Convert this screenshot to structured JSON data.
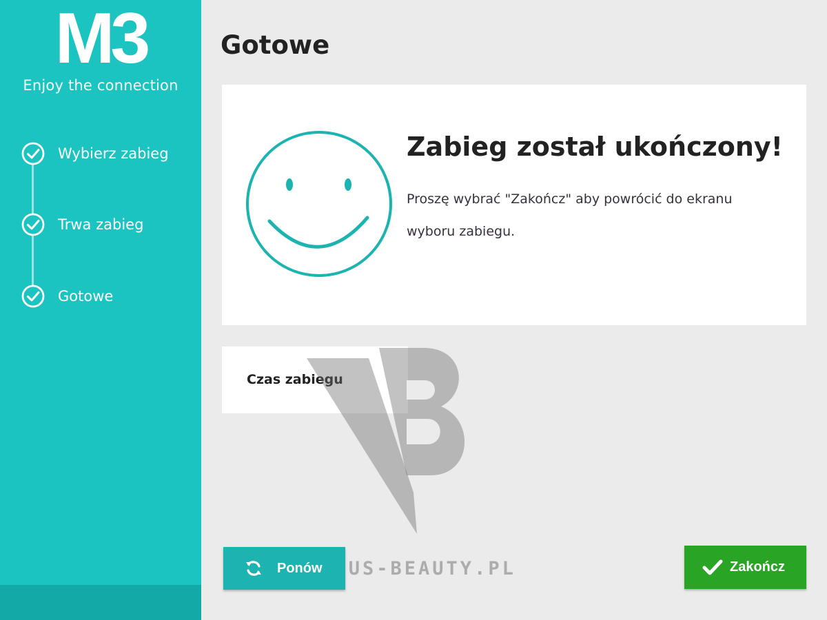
{
  "brand": {
    "logo_text": "M3",
    "tagline": "Enjoy the connection"
  },
  "sidebar": {
    "steps": [
      {
        "label": "Wybierz zabieg",
        "icon": "check-circle-icon",
        "state": "done"
      },
      {
        "label": "Trwa zabieg",
        "icon": "check-circle-icon",
        "state": "done"
      },
      {
        "label": "Gotowe",
        "icon": "check-circle-icon",
        "state": "done"
      }
    ]
  },
  "main": {
    "page_title": "Gotowe",
    "result_card": {
      "icon": "smiley-icon",
      "heading": "Zabieg został ukończony!",
      "message": "Proszę wybrać \"Zakończ\" aby powrócić do ekranu wyboru zabiegu."
    },
    "time_card": {
      "label": "Czas zabiegu"
    }
  },
  "buttons": {
    "retry_label": "Ponów",
    "finish_label": "Zakończ"
  },
  "watermark": {
    "text": "VENUS-BEAUTY.PL"
  },
  "colors": {
    "accent": "#1cc4c1",
    "sidebar_footer": "#13a9a6",
    "retry_button": "#1cb3b0",
    "finish_button": "#2aa424",
    "background": "#ebebeb"
  }
}
